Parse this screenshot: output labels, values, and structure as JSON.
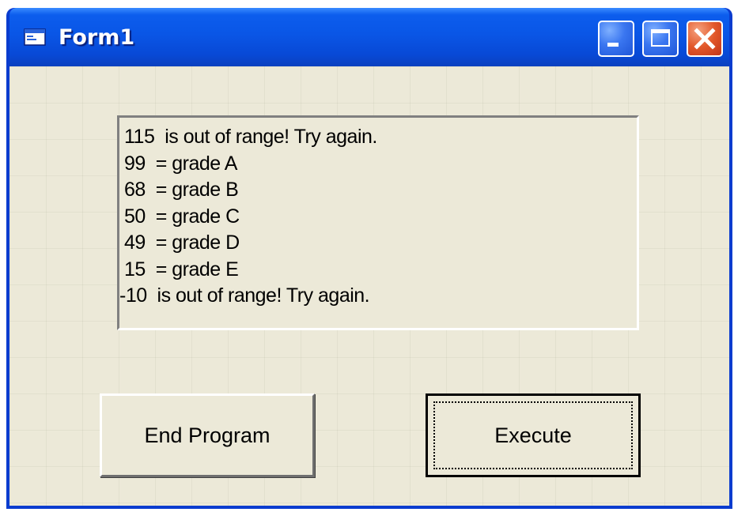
{
  "window": {
    "title": "Form1",
    "controls": {
      "minimize_icon": "minimize-icon",
      "maximize_icon": "maximize-icon",
      "close_icon": "close-icon"
    },
    "colors": {
      "titlebar": "#0a56e6",
      "client": "#ece9d8",
      "close_button": "#e2582a"
    }
  },
  "listbox": {
    "items": [
      "115  is out of range! Try again.",
      "99  = grade A",
      "68  = grade B",
      "50  = grade C",
      "49  = grade D",
      "15  = grade E",
      "-10  is out of range! Try again."
    ]
  },
  "buttons": {
    "end_program": "End Program",
    "execute": "Execute"
  }
}
